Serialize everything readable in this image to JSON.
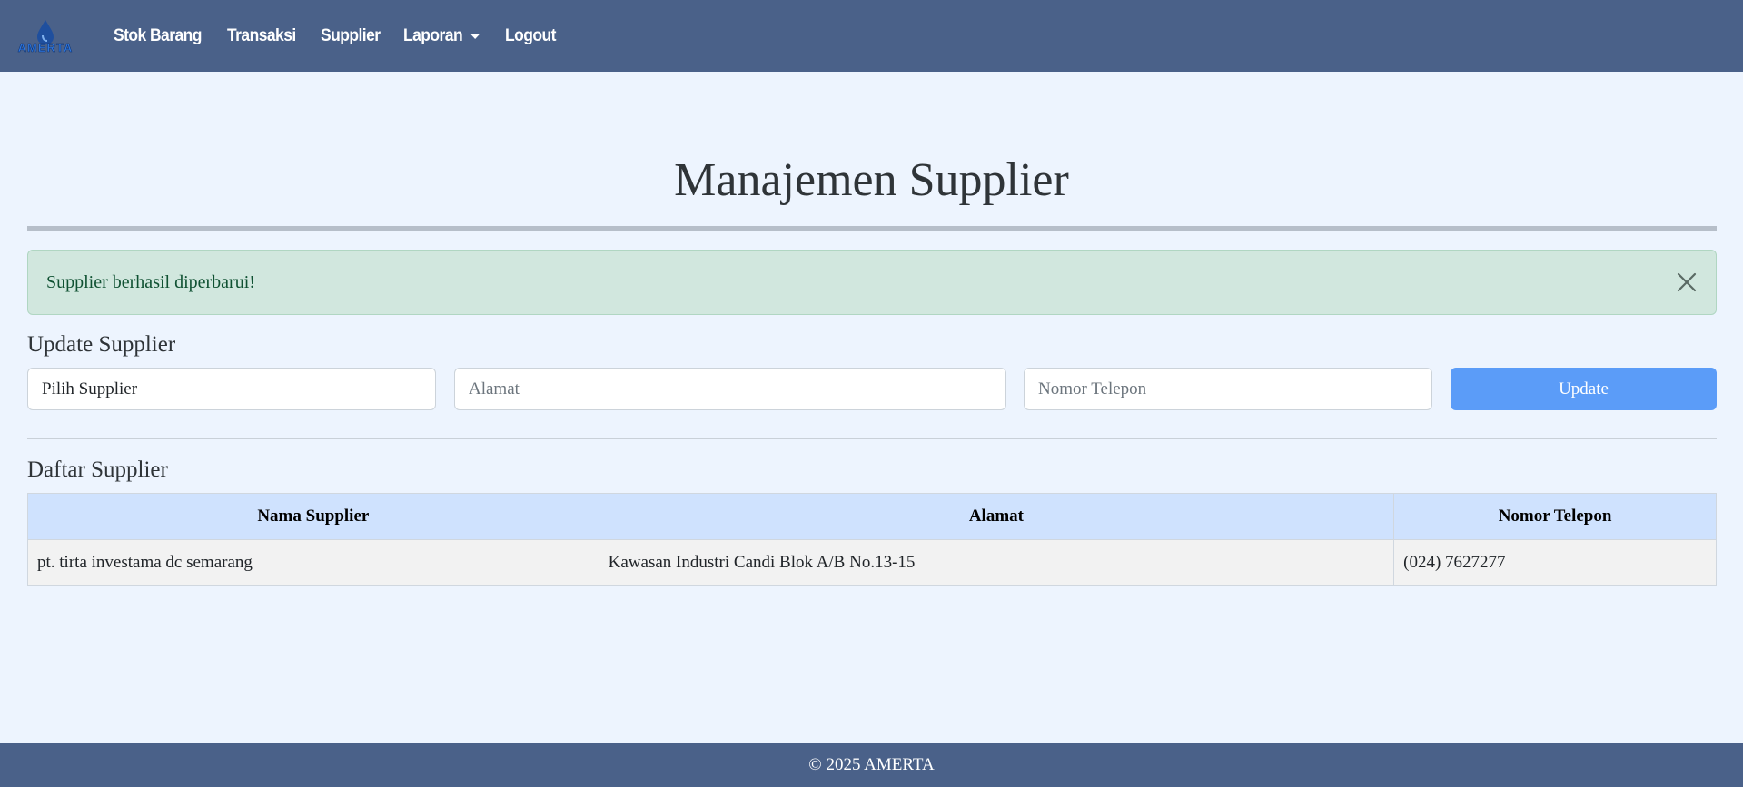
{
  "navbar": {
    "logo_text": "AMERTA",
    "links": [
      {
        "label": "Stok Barang"
      },
      {
        "label": "Transaksi"
      },
      {
        "label": "Supplier"
      },
      {
        "label": "Laporan"
      },
      {
        "label": "Logout"
      }
    ]
  },
  "page": {
    "title": "Manajemen Supplier"
  },
  "alert": {
    "message": "Supplier berhasil diperbarui!",
    "close_icon": "close-icon"
  },
  "update_form": {
    "heading": "Update Supplier",
    "supplier_select": {
      "value": "Pilih Supplier"
    },
    "alamat": {
      "value": "",
      "placeholder": "Alamat"
    },
    "telepon": {
      "value": "",
      "placeholder": "Nomor Telepon"
    },
    "submit_label": "Update"
  },
  "supplier_list": {
    "heading": "Daftar Supplier",
    "columns": [
      "Nama Supplier",
      "Alamat",
      "Nomor Telepon"
    ],
    "rows": [
      [
        "pt. tirta investama dc semarang",
        "Kawasan Industri Candi Blok A/B No.13-15",
        "(024) 7627277"
      ]
    ]
  },
  "footer": {
    "text": "© 2025 AMERTA"
  },
  "colors": {
    "navbar_bg": "#4a6189",
    "page_bg": "#edf4fe",
    "alert_bg": "#d1e7de",
    "button_bg": "#5b9cf8",
    "table_header_bg": "#cfe2fe"
  }
}
